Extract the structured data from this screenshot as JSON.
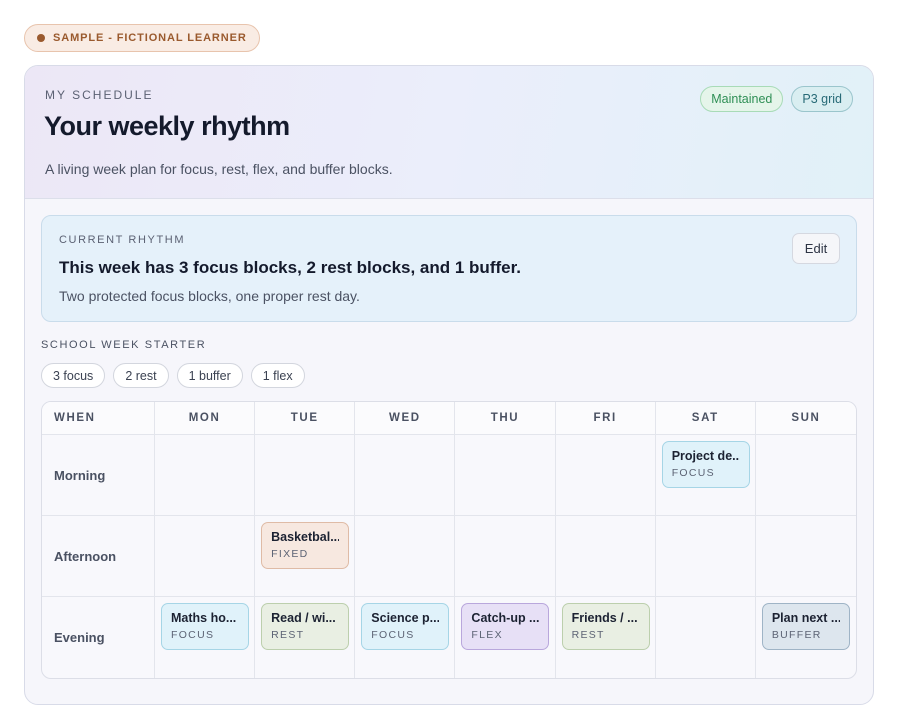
{
  "sample_badge": "SAMPLE - FICTIONAL LEARNER",
  "hero": {
    "eyebrow": "MY SCHEDULE",
    "title": "Your weekly rhythm",
    "subtitle": "A living week plan for focus, rest, flex, and buffer blocks.",
    "badges": [
      "Maintained",
      "P3 grid"
    ]
  },
  "rhythm": {
    "eyebrow": "CURRENT RHYTHM",
    "headline": "This week has 3 focus blocks, 2 rest blocks, and 1 buffer.",
    "note": "Two protected focus blocks, one proper rest day.",
    "edit_label": "Edit"
  },
  "starter": {
    "label": "SCHOOL WEEK STARTER",
    "chips": [
      "3 focus",
      "2 rest",
      "1 buffer",
      "1 flex"
    ]
  },
  "grid": {
    "when_label": "WHEN",
    "days": [
      "MON",
      "TUE",
      "WED",
      "THU",
      "FRI",
      "SAT",
      "SUN"
    ],
    "rows": [
      {
        "label": "Morning",
        "blocks": [
          null,
          null,
          null,
          null,
          null,
          {
            "title": "Project de...",
            "kind": "FOCUS"
          },
          null
        ]
      },
      {
        "label": "Afternoon",
        "blocks": [
          null,
          {
            "title": "Basketbal...",
            "kind": "FIXED"
          },
          null,
          null,
          null,
          null,
          null
        ]
      },
      {
        "label": "Evening",
        "blocks": [
          {
            "title": "Maths ho...",
            "kind": "FOCUS"
          },
          {
            "title": "Read / wi...",
            "kind": "REST"
          },
          {
            "title": "Science p...",
            "kind": "FOCUS"
          },
          {
            "title": "Catch-up ...",
            "kind": "FLEX"
          },
          {
            "title": "Friends / ...",
            "kind": "REST"
          },
          null,
          {
            "title": "Plan next ...",
            "kind": "BUFFER"
          }
        ]
      }
    ]
  }
}
